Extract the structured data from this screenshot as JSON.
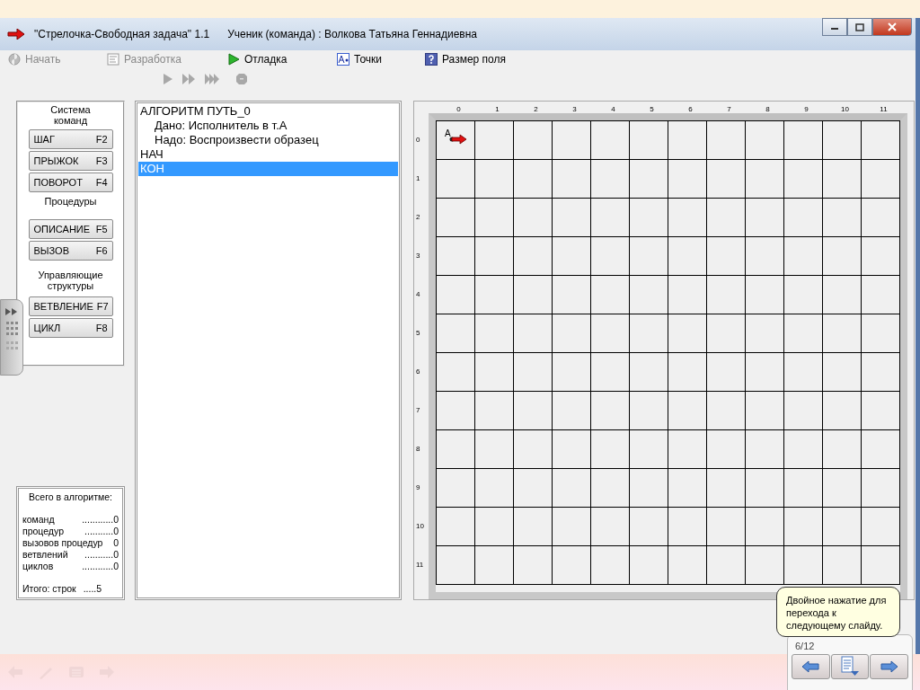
{
  "window": {
    "title": "\"Стрелочка-Свободная задача\" 1.1",
    "user": "Ученик (команда) : Волкова Татьяна Геннадиевна"
  },
  "menu": [
    {
      "kind": "start",
      "label": "Начать",
      "disabled": true
    },
    {
      "kind": "develop",
      "label": "Разработка",
      "disabled": true
    },
    {
      "kind": "debug",
      "label": "Отладка",
      "disabled": false
    },
    {
      "kind": "points",
      "label": "Точки",
      "disabled": false
    },
    {
      "kind": "size",
      "label": "Размер поля",
      "disabled": false
    }
  ],
  "commands": [
    {
      "heading": "Система команд",
      "buttons": [
        {
          "label": "ШАГ",
          "key": "F2"
        },
        {
          "label": "ПРЫЖОК",
          "key": "F3"
        },
        {
          "label": "ПОВОРОТ",
          "key": "F4"
        }
      ]
    },
    {
      "heading": "Процедуры",
      "buttons": [
        {
          "label": "ОПИСАНИЕ",
          "key": "F5"
        },
        {
          "label": "ВЫЗОВ",
          "key": "F6"
        }
      ]
    },
    {
      "heading": "Управляющие структуры",
      "buttons": [
        {
          "label": "ВЕТВЛЕНИЕ",
          "key": "F7"
        },
        {
          "label": "ЦИКЛ",
          "key": "F8"
        }
      ]
    }
  ],
  "program": [
    {
      "text": "АЛГОРИТМ ПУТЬ_0",
      "selected": false,
      "children": [
        {
          "text": "Дано: Исполнитель в т.А",
          "selected": false
        },
        {
          "text": "Надо: Воспроизвести образец",
          "selected": false
        }
      ]
    },
    {
      "text": "НАЧ",
      "selected": false
    },
    {
      "text": "КОН",
      "selected": true
    }
  ],
  "stats": {
    "title": "Всего в алгоритме:",
    "rows": [
      {
        "label": "команд",
        "value": "............0"
      },
      {
        "label": "процедур",
        "value": "...........0"
      },
      {
        "label": "вызовов процедур",
        "value": "0"
      },
      {
        "label": "ветвлений",
        "value": "...........0"
      },
      {
        "label": "циклов",
        "value": "............0"
      }
    ],
    "total_label": "Итого:  строк",
    "total_value": ".....5"
  },
  "field": {
    "columns": [
      "0",
      "1",
      "2",
      "3",
      "4",
      "5",
      "6",
      "7",
      "8",
      "9",
      "10",
      "11"
    ],
    "rows": [
      "0",
      "1",
      "2",
      "3",
      "4",
      "5",
      "6",
      "7",
      "8",
      "9",
      "10",
      "11"
    ],
    "executor_label": "A"
  },
  "tooltip": "Двойное нажатие для перехода к следующему слайду.",
  "slide_counter": "6/12"
}
